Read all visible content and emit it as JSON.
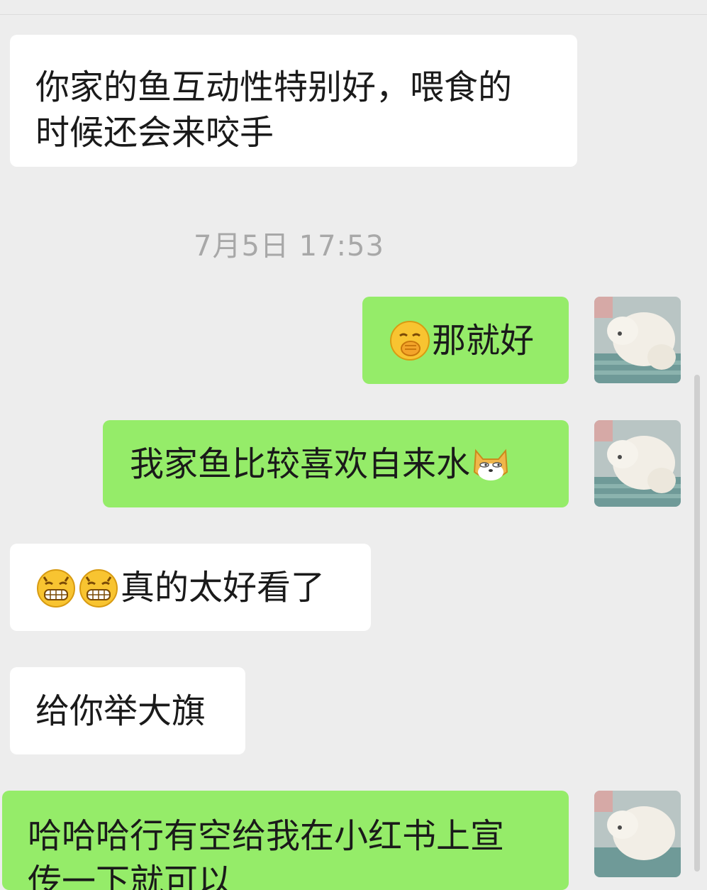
{
  "chat": {
    "timestamp": "7月5日 17:53",
    "messages": [
      {
        "side": "left",
        "text_line1": "你家的鱼互动性特别好，喂食的",
        "text_line2": "时候还会来咬手"
      },
      {
        "side": "right",
        "emoji": "facepalm-grin-emoji",
        "text": "那就好"
      },
      {
        "side": "right",
        "text": "我家鱼比较喜欢自来水",
        "emoji": "doge-emoji"
      },
      {
        "side": "left",
        "emoji": "grin-emoji",
        "text": "真的太好看了"
      },
      {
        "side": "left",
        "text": "给你举大旗"
      },
      {
        "side": "right",
        "text_line1": "哈哈哈行有空给我在小红书上宣",
        "text_line2": "传一下就可以"
      }
    ]
  },
  "colors": {
    "background": "#ededed",
    "left_bubble": "#ffffff",
    "right_bubble": "#95ec69",
    "timestamp": "#a8a8a8"
  },
  "avatar": {
    "icon": "user-avatar-dog"
  }
}
